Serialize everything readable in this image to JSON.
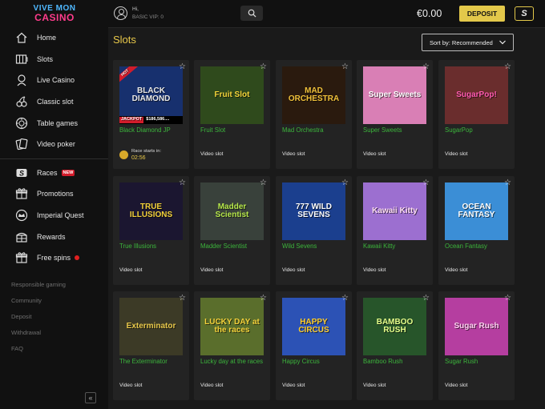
{
  "brand": {
    "line1": "VIVE MON",
    "line2": "CASINO"
  },
  "header": {
    "greeting": "Hi,",
    "vip_level": "BASIC VIP: 0",
    "balance": "€0.00",
    "deposit_label": "DEPOSIT",
    "s_button_label": "S"
  },
  "sidebar": {
    "items": [
      {
        "label": "Home",
        "icon": "home-icon"
      },
      {
        "label": "Slots",
        "icon": "slots-icon"
      },
      {
        "label": "Live Casino",
        "icon": "live-casino-icon"
      },
      {
        "label": "Classic slot",
        "icon": "classic-slot-icon"
      },
      {
        "label": "Table games",
        "icon": "table-games-icon"
      },
      {
        "label": "Video poker",
        "icon": "video-poker-icon"
      }
    ],
    "items2": [
      {
        "label": "Races",
        "icon": "races-icon",
        "badge": "NEW"
      },
      {
        "label": "Promotions",
        "icon": "gift-icon"
      },
      {
        "label": "Imperial Quest",
        "icon": "imperial-quest-icon"
      },
      {
        "label": "Rewards",
        "icon": "rewards-icon"
      },
      {
        "label": "Free spins",
        "icon": "free-spins-icon"
      }
    ],
    "links": [
      "Responsible gaming",
      "Community",
      "Deposit",
      "Withdrawal",
      "FAQ"
    ],
    "collapse_label": "«"
  },
  "main": {
    "title": "Slots",
    "sort_label": "Sort by: Recommended"
  },
  "games": [
    {
      "name": "Black Diamond JP",
      "type": "",
      "art": "BLACK DIAMOND",
      "bg": "#17306e",
      "fg": "#e9e9e9",
      "hot": "HOT",
      "jackpot_label": "JACKPOT",
      "jackpot_amount": "$186,586....",
      "race_label": "Race starts in:",
      "race_time": "02:56"
    },
    {
      "name": "Fruit Slot",
      "type": "Video slot",
      "art": "Fruit Slot",
      "bg": "#2f4a1c",
      "fg": "#f5d53a"
    },
    {
      "name": "Mad Orchestra",
      "type": "Video slot",
      "art": "MAD ORCHESTRA",
      "bg": "#2a1a0e",
      "fg": "#f0c13a"
    },
    {
      "name": "Super Sweets",
      "type": "Video slot",
      "art": "Super Sweets",
      "bg": "#d97fb5",
      "fg": "#ffffff"
    },
    {
      "name": "SugarPop",
      "type": "Video slot",
      "art": "SugarPop!",
      "bg": "#6a2d2d",
      "fg": "#ff5ab0"
    },
    {
      "name": "True Illusions",
      "type": "Video slot",
      "art": "TRUE ILLUSIONS",
      "bg": "#1b1630",
      "fg": "#f3d13a"
    },
    {
      "name": "Madder Scientist",
      "type": "Video slot",
      "art": "Madder Scientist",
      "bg": "#39413b",
      "fg": "#b7e84a"
    },
    {
      "name": "Wild Sevens",
      "type": "Video slot",
      "art": "777 WILD SEVENS",
      "bg": "#1b3f8e",
      "fg": "#ffffff"
    },
    {
      "name": "Kawaii Kitty",
      "type": "Video slot",
      "art": "Kawaii Kitty",
      "bg": "#9c6fd0",
      "fg": "#ffe0f2"
    },
    {
      "name": "Ocean Fantasy",
      "type": "Video slot",
      "art": "OCEAN FANTASY",
      "bg": "#3b8ed6",
      "fg": "#ffffff"
    },
    {
      "name": "The Exterminator",
      "type": "Video slot",
      "art": "Exterminator",
      "bg": "#3c3a26",
      "fg": "#e8c84a"
    },
    {
      "name": "Lucky day at the races",
      "type": "Video slot",
      "art": "LUCKY DAY at the races",
      "bg": "#5a6e2c",
      "fg": "#f4d13a"
    },
    {
      "name": "Happy Circus",
      "type": "Video slot",
      "art": "HAPPY CIRCUS",
      "bg": "#2c52b5",
      "fg": "#ffcf2e"
    },
    {
      "name": "Bamboo Rush",
      "type": "Video slot",
      "art": "BAMBOO RUSH",
      "bg": "#27552a",
      "fg": "#e6ff8a"
    },
    {
      "name": "Sugar Rush",
      "type": "Video slot",
      "art": "Sugar Rush",
      "bg": "#b53ea0",
      "fg": "#ffd3f1"
    }
  ]
}
